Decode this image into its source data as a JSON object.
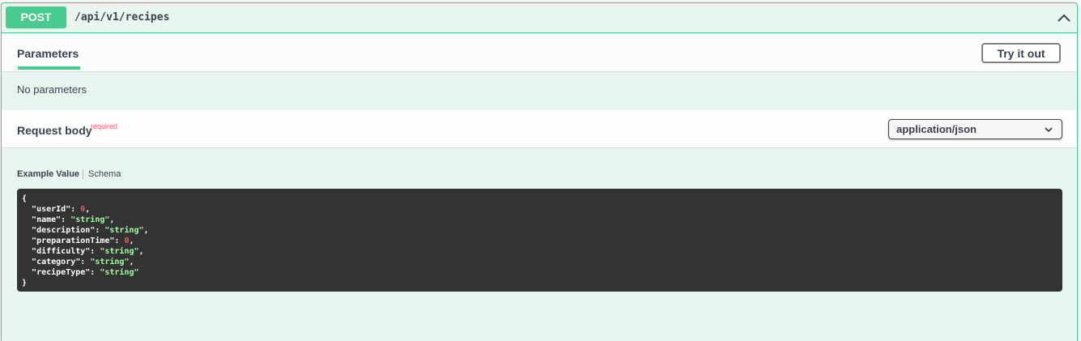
{
  "operation": {
    "method": "POST",
    "path": "/api/v1/recipes",
    "method_color": "#49cc90"
  },
  "parameters": {
    "tab_label": "Parameters",
    "try_button_label": "Try it out",
    "empty_text": "No parameters"
  },
  "request_body": {
    "label": "Request body",
    "required_label": "required",
    "content_type": "application/json"
  },
  "example": {
    "tab_example_label": "Example Value",
    "tab_schema_label": "Schema",
    "open_brace": "{",
    "close_brace": "}",
    "fields": [
      {
        "key": "\"userId\"",
        "value": "0",
        "type": "number",
        "trail": ","
      },
      {
        "key": "\"name\"",
        "value": "\"string\"",
        "type": "string",
        "trail": ","
      },
      {
        "key": "\"description\"",
        "value": "\"string\"",
        "type": "string",
        "trail": ","
      },
      {
        "key": "\"preparationTime\"",
        "value": "0",
        "type": "number",
        "trail": ","
      },
      {
        "key": "\"difficulty\"",
        "value": "\"string\"",
        "type": "string",
        "trail": ","
      },
      {
        "key": "\"category\"",
        "value": "\"string\"",
        "type": "string",
        "trail": ","
      },
      {
        "key": "\"recipeType\"",
        "value": "\"string\"",
        "type": "string",
        "trail": ""
      }
    ]
  },
  "icons": {
    "collapse": "chevron-up-icon",
    "select": "chevron-down-icon"
  }
}
